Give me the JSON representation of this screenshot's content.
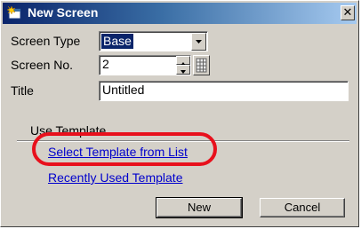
{
  "window": {
    "title": "New Screen",
    "close_glyph": "✕"
  },
  "form": {
    "screen_type_label": "Screen Type",
    "screen_type_value": "Base",
    "screen_no_label": "Screen No.",
    "screen_no_value": "2",
    "title_label": "Title",
    "title_value": "Untitled"
  },
  "template": {
    "group_label": "Use Template",
    "select_link": "Select Template from List",
    "recent_link": "Recently Used Template"
  },
  "buttons": {
    "new_label": "New",
    "cancel_label": "Cancel"
  },
  "annotation": {
    "color": "#e8101c"
  }
}
